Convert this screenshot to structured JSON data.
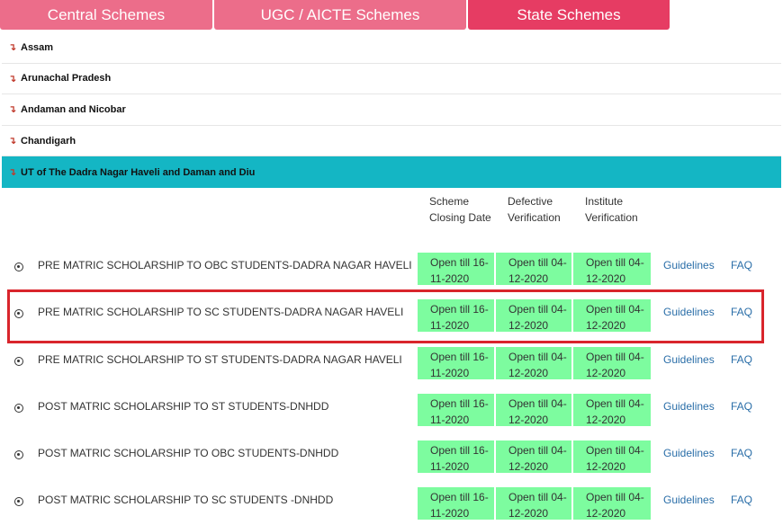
{
  "tabs": {
    "central": "Central Schemes",
    "ugc": "UGC / AICTE Schemes",
    "state": "State Schemes"
  },
  "states": [
    {
      "label": "Assam"
    },
    {
      "label": "Arunachal Pradesh"
    },
    {
      "label": "Andaman and Nicobar"
    },
    {
      "label": "Chandigarh"
    },
    {
      "label": "UT of The Dadra Nagar Haveli and Daman and Diu"
    }
  ],
  "columns": {
    "closing": "Scheme Closing Date",
    "defective": "Defective Verification",
    "institute": "Institute Verification"
  },
  "schemes": [
    {
      "name": "PRE MATRIC SCHOLARSHIP TO OBC STUDENTS-DADRA NAGAR HAVELI",
      "closing": "Open till 16-11-2020",
      "defective": "Open till 04-12-2020",
      "institute": "Open till 04-12-2020"
    },
    {
      "name": "PRE MATRIC SCHOLARSHIP TO SC STUDENTS-DADRA NAGAR HAVELI",
      "closing": "Open till 16-11-2020",
      "defective": "Open till 04-12-2020",
      "institute": "Open till 04-12-2020"
    },
    {
      "name": "PRE MATRIC SCHOLARSHIP TO ST STUDENTS-DADRA NAGAR HAVELI",
      "closing": "Open till 16-11-2020",
      "defective": "Open till 04-12-2020",
      "institute": "Open till 04-12-2020"
    },
    {
      "name": "POST MATRIC SCHOLARSHIP TO ST STUDENTS-DNHDD",
      "closing": "Open till 16-11-2020",
      "defective": "Open till 04-12-2020",
      "institute": "Open till 04-12-2020"
    },
    {
      "name": "POST MATRIC SCHOLARSHIP TO OBC STUDENTS-DNHDD",
      "closing": "Open till 16-11-2020",
      "defective": "Open till 04-12-2020",
      "institute": "Open till 04-12-2020"
    },
    {
      "name": "POST MATRIC SCHOLARSHIP TO SC STUDENTS -DNHDD",
      "closing": "Open till 16-11-2020",
      "defective": "Open till 04-12-2020",
      "institute": "Open till 04-12-2020"
    }
  ],
  "links": {
    "guidelines": "Guidelines",
    "faq": "FAQ"
  },
  "icons": {
    "state_arrow": "arrow-down-right-icon",
    "scheme_radio": "radio-selected-icon"
  },
  "colors": {
    "tab_inactive": "#ec6d8a",
    "tab_active": "#e63c63",
    "state_active": "#14b6c4",
    "open_cell": "#7dfc9f",
    "highlight": "#d9252c",
    "link": "#2a6ea8"
  }
}
